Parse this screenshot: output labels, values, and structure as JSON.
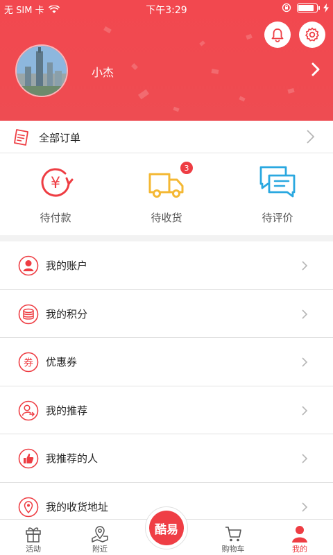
{
  "status_bar": {
    "carrier": "无 SIM 卡",
    "time": "下午3:29"
  },
  "profile": {
    "username": "小杰"
  },
  "orders": {
    "label": "全部订单"
  },
  "order_status": [
    {
      "label": "待付款",
      "icon": "yuan-clock-icon"
    },
    {
      "label": "待收货",
      "icon": "truck-icon",
      "badge": "3"
    },
    {
      "label": "待评价",
      "icon": "chat-bubbles-icon"
    }
  ],
  "menu": [
    {
      "label": "我的账户",
      "icon": "user-icon"
    },
    {
      "label": "我的积分",
      "icon": "coins-icon"
    },
    {
      "label": "优惠券",
      "icon": "coupon-icon",
      "icon_text": "券"
    },
    {
      "label": "我的推荐",
      "icon": "recommend-icon"
    },
    {
      "label": "我推荐的人",
      "icon": "thumbs-up-icon"
    },
    {
      "label": "我的收货地址",
      "icon": "location-icon"
    }
  ],
  "tabbar": {
    "items": [
      {
        "label": "活动",
        "icon": "gift-icon"
      },
      {
        "label": "附近",
        "icon": "map-pin-icon"
      },
      {
        "label": "购物车",
        "icon": "cart-icon"
      },
      {
        "label": "我的",
        "icon": "person-icon",
        "active": true
      }
    ],
    "center_label": "酷易"
  },
  "colors": {
    "brand": "#ee3d43",
    "header": "#f2484f"
  }
}
